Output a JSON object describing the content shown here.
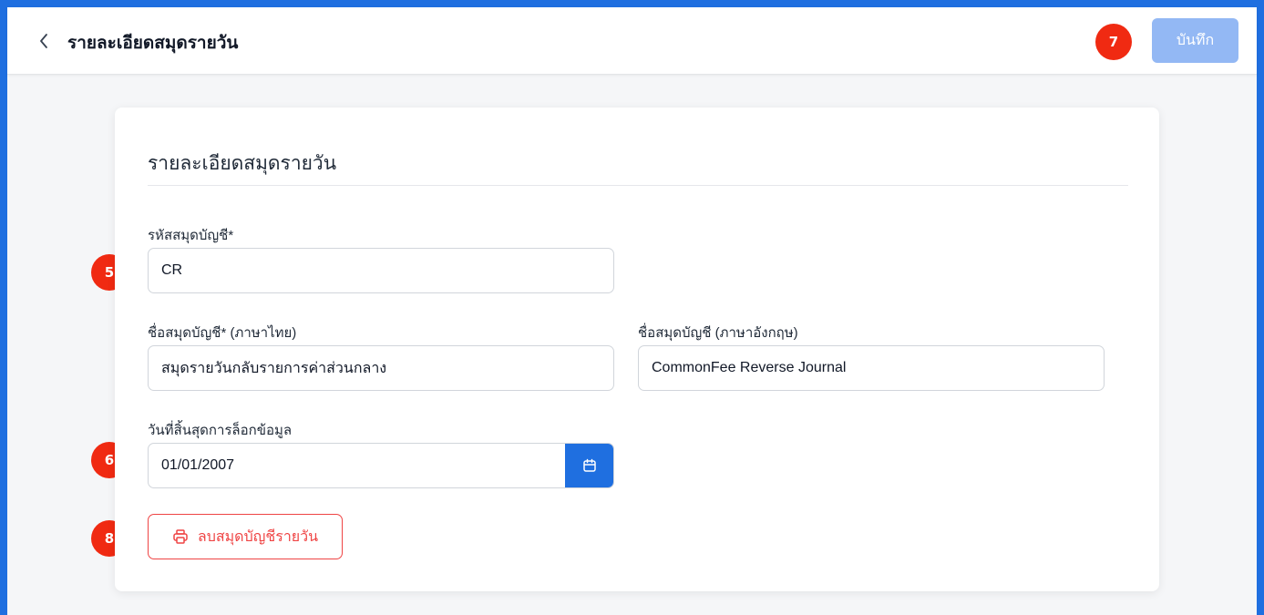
{
  "header": {
    "title": "รายละเอียดสมุดรายวัน",
    "save_label": "บันทึก",
    "save_badge": "7"
  },
  "card": {
    "title": "รายละเอียดสมุดรายวัน",
    "code": {
      "label": "รหัสสมุดบัญชี*",
      "value": "CR",
      "badge": "5"
    },
    "name_th": {
      "label": "ชื่อสมุดบัญชี* (ภาษาไทย)",
      "value": "สมุดรายวันกลับรายการค่าส่วนกลาง"
    },
    "name_en": {
      "label": "ชื่อสมุดบัญชี (ภาษาอังกฤษ)",
      "value": "CommonFee Reverse Journal"
    },
    "lock_date": {
      "label": "วันที่สิ้นสุดการล็อกข้อมูล",
      "value": "01/01/2007",
      "badge": "6"
    },
    "delete": {
      "label": "ลบสมุดบัญชีรายวัน",
      "badge": "8",
      "icon": "printer-icon"
    }
  },
  "colors": {
    "frame": "#1f6fe0",
    "badge": "#f02a12",
    "save_button": "#93b8f4",
    "calendar_button": "#1f6fe0",
    "danger": "#ef4444"
  }
}
